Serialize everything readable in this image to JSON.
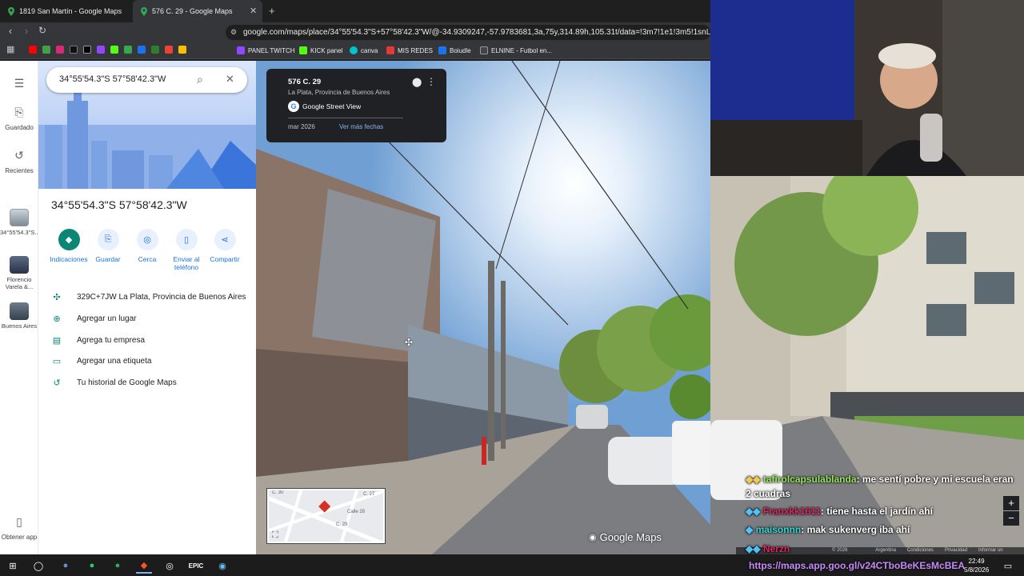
{
  "browser": {
    "tabs": [
      {
        "title": "1819 San Martín - Google Maps",
        "active": false
      },
      {
        "title": "576 C. 29 - Google Maps",
        "active": true
      }
    ],
    "new_tab": "+",
    "url": "google.com/maps/place/34°55'54.3\"S+57°58'42.3\"W/@-34.9309247,-57.9783681,3a,75y,314.89h,105.31t/data=!3m7!1e1!3m5!1snLoUo2_krTft",
    "bookmarks": [
      {
        "label": "PANEL TWITCH",
        "color": "#9146ff"
      },
      {
        "label": "KICK panel",
        "color": "#53fc18"
      },
      {
        "label": "canva",
        "color": "#00c4cc"
      },
      {
        "label": "MIS REDES",
        "color": "#e53935"
      },
      {
        "label": "Boiudle",
        "color": "#1a73e8"
      },
      {
        "label": "ELNINE - Futbol en...",
        "color": "#444444"
      }
    ]
  },
  "rail": {
    "saved": "Guardado",
    "recents": "Recientes",
    "recent_items": [
      {
        "label": "34°55'54.3\"S..."
      },
      {
        "label": "Florencio Varela &..."
      },
      {
        "label": "Buenos Aires"
      }
    ],
    "get_app": "Obtener app"
  },
  "search": {
    "value": "34°55'54.3\"S 57°58'42.3\"W"
  },
  "place": {
    "title": "34°55'54.3\"S 57°58'42.3\"W",
    "actions": [
      {
        "label": "Indicaciones",
        "icon": "directions-icon"
      },
      {
        "label": "Guardar",
        "icon": "bookmark-icon"
      },
      {
        "label": "Cerca",
        "icon": "nearby-icon"
      },
      {
        "label": "Enviar al teléfono",
        "icon": "phone-icon"
      },
      {
        "label": "Compartir",
        "icon": "share-icon"
      }
    ],
    "rows": [
      {
        "label": "329C+7JW La Plata, Provincia de Buenos Aires",
        "icon": "pluscode-icon"
      },
      {
        "label": "Agregar un lugar",
        "icon": "add-place-icon"
      },
      {
        "label": "Agrega tu empresa",
        "icon": "business-icon"
      },
      {
        "label": "Agregar una etiqueta",
        "icon": "label-icon"
      },
      {
        "label": "Tu historial de Google Maps",
        "icon": "history-icon"
      }
    ]
  },
  "streetview": {
    "address": "576 C. 29",
    "locality": "La Plata, Provincia de Buenos Aires",
    "provider": "Google Street View",
    "date": "mar 2026",
    "more_dates": "Ver más fechas",
    "watermark": "Google Maps",
    "minimap_labels": [
      "C. 27",
      "Calle 28",
      "C. 29",
      "C. 30"
    ],
    "footer": [
      "© 2026 Google",
      "Argentina",
      "Condiciones",
      "Privacidad",
      "Informar un problema"
    ]
  },
  "chat": [
    {
      "user": "tafirolcapsulablanda",
      "user_color": "#9ae65a",
      "message": ": me sentí pobre y mi escuela eran 2 cuadras"
    },
    {
      "user": "Franxkk1611",
      "user_color": "#e0245e",
      "message": ": tiene hasta el jardín ahí"
    },
    {
      "user": "maisonnn",
      "user_color": "#3ad6d6",
      "message": ": mak sukenverg iba ahí"
    },
    {
      "user": "Nerzn",
      "user_color": "#e0245e",
      "message": ""
    }
  ],
  "stream_url": "https://maps.app.goo.gl/v24CTboBeKEsMcBEA",
  "taskbar": {
    "time": "22:49",
    "date": "5/8/2026"
  }
}
